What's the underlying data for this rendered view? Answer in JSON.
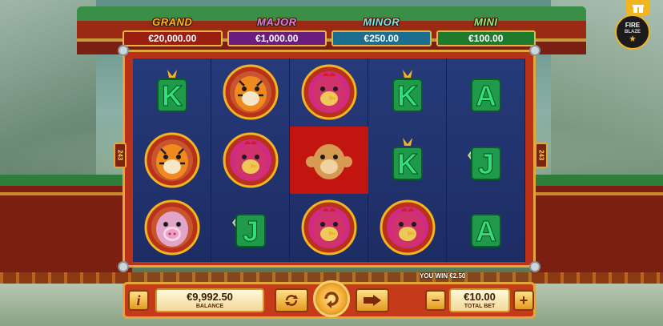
{
  "jackpots": [
    {
      "name": "GRAND",
      "value": "€20,000.00",
      "title_color": "#ffb21e",
      "bg": "#9c1e13"
    },
    {
      "name": "MAJOR",
      "value": "€1,000.00",
      "title_color": "#d77ce8",
      "bg": "#6a1d7e"
    },
    {
      "name": "MINOR",
      "value": "€250.00",
      "title_color": "#7fe0ef",
      "bg": "#1b6e8f"
    },
    {
      "name": "MINI",
      "value": "€100.00",
      "title_color": "#8ef07a",
      "bg": "#1e7a2c"
    }
  ],
  "ways": "243",
  "reels": [
    [
      "K-symbol",
      "tiger-symbol",
      "pig-symbol"
    ],
    [
      "tiger-symbol",
      "rooster-symbol",
      "J-symbol"
    ],
    [
      "rooster-symbol",
      "monkey-symbol",
      "rooster-symbol"
    ],
    [
      "K-symbol",
      "K-symbol",
      "rooster-symbol"
    ],
    [
      "A-symbol",
      "J-symbol",
      "A-symbol"
    ]
  ],
  "win_cell": {
    "reel": 2,
    "row": 1
  },
  "controls": {
    "info_label": "i",
    "balance_value": "€9,992.50",
    "balance_label": "BALANCE",
    "you_win": "YOU WIN €2.50",
    "bet_value": "€10.00",
    "bet_label": "TOTAL BET",
    "minus_label": "−",
    "plus_label": "+"
  },
  "brand": {
    "line1": "FIRE",
    "line2": "BLAZE"
  },
  "colors": {
    "accent": "#e4a53d",
    "reel_bg": "#1d2c63",
    "frame": "#b8321a"
  }
}
